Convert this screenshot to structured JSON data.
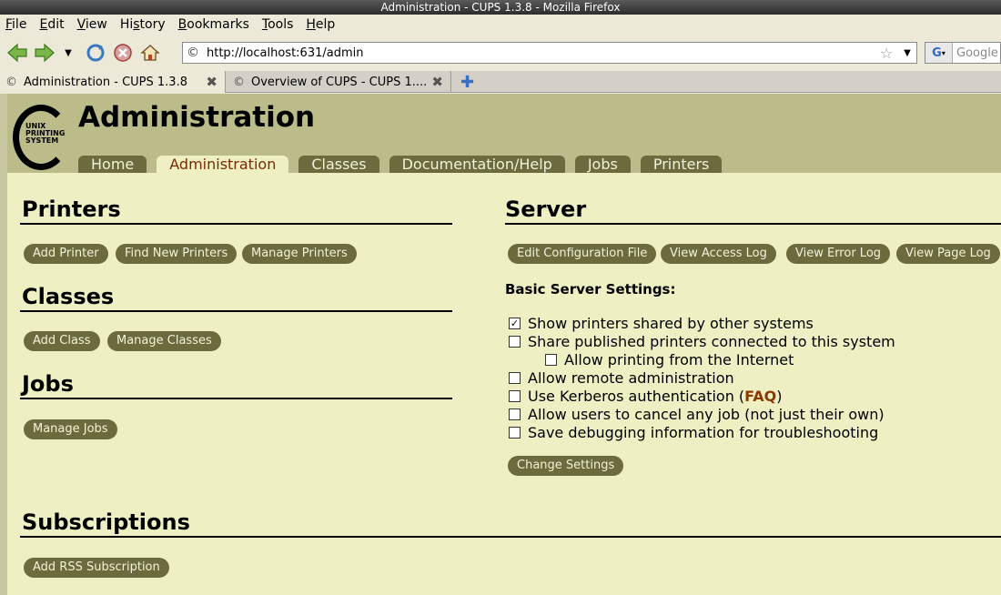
{
  "window": {
    "title": "Administration - CUPS 1.3.8 - Mozilla Firefox"
  },
  "menu": [
    "File",
    "Edit",
    "View",
    "History",
    "Bookmarks",
    "Tools",
    "Help"
  ],
  "menu_underline": [
    "F",
    "E",
    "V",
    "s",
    "B",
    "T",
    "H"
  ],
  "address": {
    "url": "http://localhost:631/admin"
  },
  "search": {
    "placeholder": "Google"
  },
  "tabs": [
    {
      "label": "Administration - CUPS 1.3.8"
    },
    {
      "label": "Overview of CUPS - CUPS 1...."
    }
  ],
  "logo": {
    "line1": "UNIX",
    "line2": "PRINTING",
    "line3": "SYSTEM"
  },
  "page": {
    "title": "Administration"
  },
  "nav": [
    "Home",
    "Administration",
    "Classes",
    "Documentation/Help",
    "Jobs",
    "Printers"
  ],
  "printers": {
    "title": "Printers",
    "buttons": [
      "Add Printer",
      "Find New Printers",
      "Manage Printers"
    ]
  },
  "classes": {
    "title": "Classes",
    "buttons": [
      "Add Class",
      "Manage Classes"
    ]
  },
  "jobs": {
    "title": "Jobs",
    "buttons": [
      "Manage Jobs"
    ]
  },
  "server": {
    "title": "Server",
    "buttons": [
      "Edit Configuration File",
      "View Access Log",
      "View Error Log",
      "View Page Log"
    ],
    "settings_title": "Basic Server Settings:",
    "settings": [
      {
        "label": "Show printers shared by other systems",
        "checked": true
      },
      {
        "label": "Share published printers connected to this system",
        "checked": false
      },
      {
        "label": "Allow printing from the Internet",
        "checked": false
      },
      {
        "label": "Allow remote administration",
        "checked": false
      },
      {
        "label": "Use Kerberos authentication (",
        "link": "FAQ",
        "suffix": ")",
        "checked": false
      },
      {
        "label": "Allow users to cancel any job (not just their own)",
        "checked": false
      },
      {
        "label": "Save debugging information for troubleshooting",
        "checked": false
      }
    ],
    "change_button": "Change Settings"
  },
  "subscriptions": {
    "title": "Subscriptions",
    "buttons": [
      "Add RSS Subscription"
    ]
  }
}
